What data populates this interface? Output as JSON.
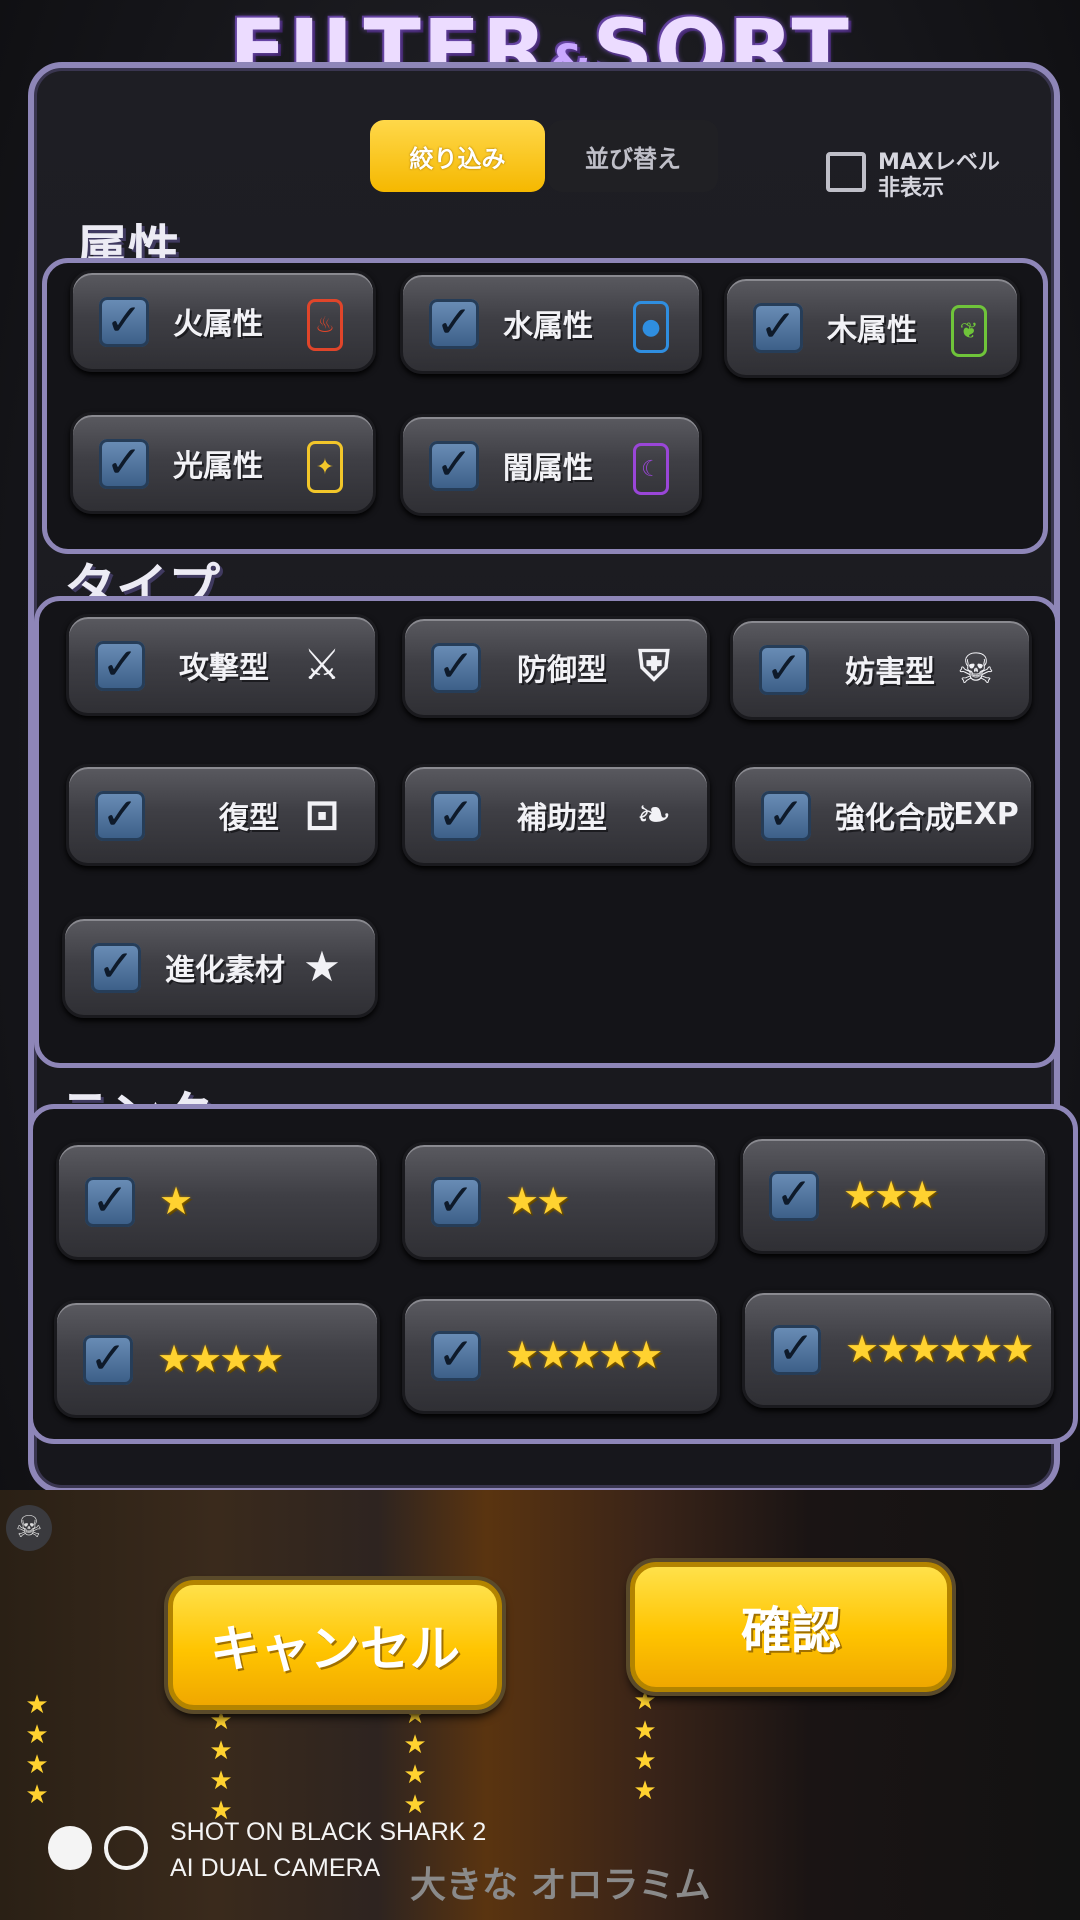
{
  "header": {
    "title_left": "FILTER",
    "title_amp": "&",
    "title_right": "SORT"
  },
  "tabs": {
    "filter": "絞り込み",
    "sort": "並び替え"
  },
  "max_level": {
    "label_line1": "MAXレベル",
    "label_line2": "非表示",
    "checked": false
  },
  "attribute": {
    "heading": "属性",
    "items": [
      {
        "label": "火属性",
        "checked": true,
        "icon": "fire-icon",
        "color": "#e0452a"
      },
      {
        "label": "水属性",
        "checked": true,
        "icon": "water-drop-icon",
        "color": "#2f8ee0"
      },
      {
        "label": "木属性",
        "checked": true,
        "icon": "leaf-icon",
        "color": "#6fc43a"
      },
      {
        "label": "光属性",
        "checked": true,
        "icon": "light-icon",
        "color": "#f2c62a"
      },
      {
        "label": "闇属性",
        "checked": true,
        "icon": "moon-icon",
        "color": "#9a46d8"
      }
    ]
  },
  "type": {
    "heading": "タイプ",
    "items": [
      {
        "label": "攻撃型",
        "checked": true,
        "icon": "crossed-swords-icon"
      },
      {
        "label": "防御型",
        "checked": true,
        "icon": "shield-icon"
      },
      {
        "label": "妨害型",
        "checked": true,
        "icon": "skull-icon"
      },
      {
        "label": "復型",
        "checked": true,
        "icon": "recovery-icon"
      },
      {
        "label": "補助型",
        "checked": true,
        "icon": "wing-icon"
      },
      {
        "label": "強化合成",
        "checked": true,
        "icon": "exp-icon",
        "icon_text": "EXP"
      },
      {
        "label": "進化素材",
        "checked": true,
        "icon": "star-plus-icon"
      }
    ]
  },
  "rank": {
    "heading": "ランク",
    "items": [
      {
        "stars": 1,
        "checked": true
      },
      {
        "stars": 2,
        "checked": true
      },
      {
        "stars": 3,
        "checked": true
      },
      {
        "stars": 4,
        "checked": true
      },
      {
        "stars": 5,
        "checked": true
      },
      {
        "stars": 6,
        "checked": true
      }
    ]
  },
  "buttons": {
    "cancel": "キャンセル",
    "confirm": "確認"
  },
  "background": {
    "bottom_text": "大きな オロラミム"
  },
  "watermark": {
    "line1": "SHOT ON BLACK SHARK 2",
    "line2": "AI DUAL CAMERA"
  }
}
